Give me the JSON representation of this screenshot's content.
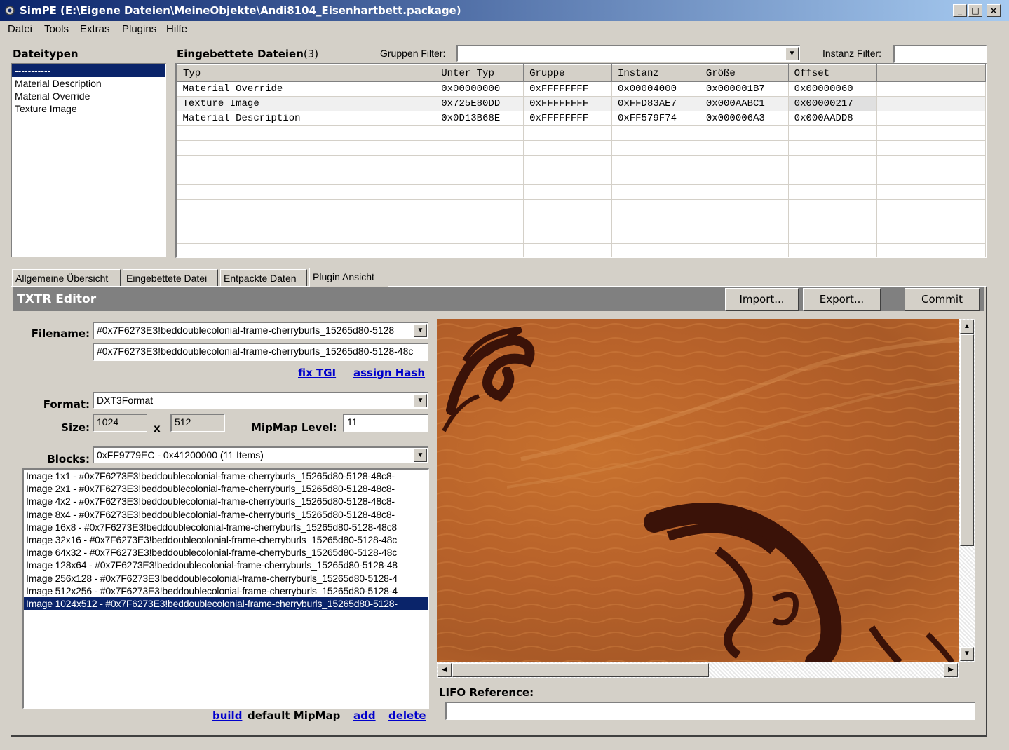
{
  "window": {
    "title": "SimPE (E:\\Eigene Dateien\\MeineObjekte\\Andi8104_Eisenhartbett.package)",
    "minimize": "_",
    "maximize": "□",
    "close": "×"
  },
  "menu": [
    "Datei",
    "Tools",
    "Extras",
    "Plugins",
    "Hilfe"
  ],
  "filetypes": {
    "heading": "Dateitypen",
    "items": [
      "-----------",
      "Material Description",
      "Material Override",
      "Texture Image"
    ]
  },
  "embedded": {
    "heading": "Eingebettete Dateien",
    "count": "(3)",
    "group_filter_label": "Gruppen Filter:",
    "group_filter_value": "",
    "instance_filter_label": "Instanz Filter:",
    "instance_filter_value": "",
    "columns": [
      "Typ",
      "Unter Typ",
      "Gruppe",
      "Instanz",
      "Größe",
      "Offset"
    ],
    "rows": [
      [
        "Material Override",
        "0x00000000",
        "0xFFFFFFFF",
        "0x00004000",
        "0x000001B7",
        "0x00000060"
      ],
      [
        "Texture Image",
        "0x725E80DD",
        "0xFFFFFFFF",
        "0xFFD83AE7",
        "0x000AABC1",
        "0x00000217"
      ],
      [
        "Material Description",
        "0x0D13B68E",
        "0xFFFFFFFF",
        "0xFF579F74",
        "0x000006A3",
        "0x000AADD8"
      ]
    ]
  },
  "tabs": [
    "Allgemeine Übersicht",
    "Eingebettete Datei",
    "Entpackte Daten",
    "Plugin Ansicht"
  ],
  "editor": {
    "title": "TXTR Editor",
    "import_label": "Import...",
    "export_label": "Export...",
    "commit_label": "Commit",
    "filename_label": "Filename:",
    "filename_combo": "#0x7F6273E3!beddoublecolonial-frame-cherryburls_15265d80-5128",
    "filename_text": "#0x7F6273E3!beddoublecolonial-frame-cherryburls_15265d80-5128-48c",
    "fix_tgi": "fix TGI",
    "assign_hash": "assign Hash",
    "format_label": "Format:",
    "format_value": "DXT3Format",
    "size_label": "Size:",
    "width": "1024",
    "x_label": "x",
    "height": "512",
    "mipmap_label": "MipMap Level:",
    "mipmap_value": "11",
    "blocks_label": "Blocks:",
    "blocks_value": "0xFF9779EC - 0x41200000 (11 Items)",
    "block_items": [
      "Image 1x1 - #0x7F6273E3!beddoublecolonial-frame-cherryburls_15265d80-5128-48c8-",
      "Image 2x1 - #0x7F6273E3!beddoublecolonial-frame-cherryburls_15265d80-5128-48c8-",
      "Image 4x2 - #0x7F6273E3!beddoublecolonial-frame-cherryburls_15265d80-5128-48c8-",
      "Image 8x4 - #0x7F6273E3!beddoublecolonial-frame-cherryburls_15265d80-5128-48c8-",
      "Image 16x8 - #0x7F6273E3!beddoublecolonial-frame-cherryburls_15265d80-5128-48c8",
      "Image 32x16 - #0x7F6273E3!beddoublecolonial-frame-cherryburls_15265d80-5128-48c",
      "Image 64x32 - #0x7F6273E3!beddoublecolonial-frame-cherryburls_15265d80-5128-48c",
      "Image 128x64 - #0x7F6273E3!beddoublecolonial-frame-cherryburls_15265d80-5128-48",
      "Image 256x128 - #0x7F6273E3!beddoublecolonial-frame-cherryburls_15265d80-5128-4",
      "Image 512x256 - #0x7F6273E3!beddoublecolonial-frame-cherryburls_15265d80-5128-4",
      "Image 1024x512 - #0x7F6273E3!beddoublecolonial-frame-cherryburls_15265d80-5128-"
    ],
    "build_link": "build",
    "default_mipmap_text": "default MipMap",
    "add_link": "add",
    "delete_link": "delete",
    "lifo_label": "LIFO Reference:",
    "lifo_value": ""
  },
  "colors": {
    "selection": "#0a246a",
    "editor_bar": "#808080",
    "link": "#0000cc",
    "texture_base": "#b8622a",
    "ornament": "#3a1208"
  }
}
